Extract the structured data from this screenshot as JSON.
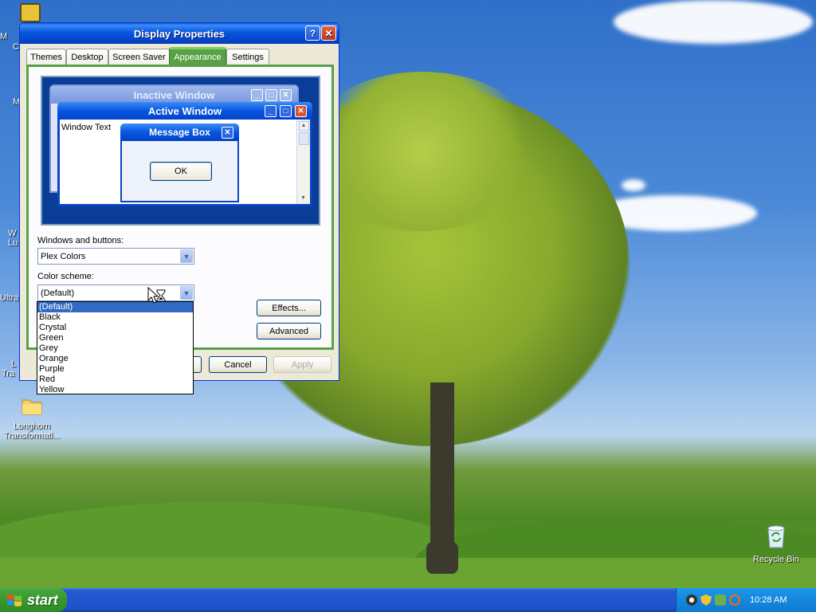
{
  "desktop": {
    "icons": [
      {
        "label": "Longhorn Transformati...",
        "icon": "folder-icon"
      },
      {
        "label": "Recycle Bin",
        "icon": "recycle-bin-icon"
      }
    ],
    "edge_labels": [
      "M",
      "C",
      "M",
      "W",
      "Lu",
      "Ultra",
      "L",
      "Tra"
    ]
  },
  "dialog": {
    "title": "Display Properties",
    "help_label": "?",
    "close_label": "✕",
    "tabs": [
      {
        "label": "Themes",
        "selected": false
      },
      {
        "label": "Desktop",
        "selected": false
      },
      {
        "label": "Screen Saver",
        "selected": false
      },
      {
        "label": "Appearance",
        "selected": true
      },
      {
        "label": "Settings",
        "selected": false
      }
    ],
    "preview": {
      "inactive_title": "Inactive Window",
      "active_title": "Active Window",
      "window_text": "Window Text",
      "message_title": "Message Box",
      "ok_label": "OK"
    },
    "windows_buttons_label": "Windows and buttons:",
    "windows_buttons_value": "Plex Colors",
    "color_scheme_label": "Color scheme:",
    "color_scheme_value": "(Default)",
    "color_scheme_options": [
      "(Default)",
      "Black",
      "Crystal",
      "Green",
      "Grey",
      "Orange",
      "Purple",
      "Red",
      "Yellow"
    ],
    "selected_option": "(Default)",
    "effects_label": "Effects...",
    "advanced_label": "Advanced",
    "cancel_label": "Cancel",
    "apply_label": "Apply"
  },
  "taskbar": {
    "start_label": "start",
    "clock": "10:28 AM"
  },
  "colors": {
    "title_blue": "#0756e1",
    "tab_green": "#5aa047",
    "selection_blue": "#316ac5"
  }
}
